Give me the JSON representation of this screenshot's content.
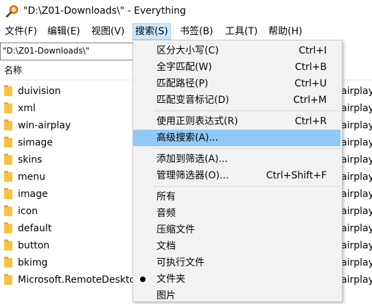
{
  "window": {
    "title": "\"D:\\Z01-Downloads\\\"  - Everything"
  },
  "menubar": {
    "items": [
      {
        "label": "文件(F)"
      },
      {
        "label": "编辑(E)"
      },
      {
        "label": "视图(V)"
      },
      {
        "label": "搜索(S)",
        "active": true
      },
      {
        "label": "书签(B)"
      },
      {
        "label": "工具(T)"
      },
      {
        "label": "帮助(H)"
      }
    ]
  },
  "search": {
    "value": "\"D:\\Z01-Downloads\\\""
  },
  "columns": {
    "name": "名称"
  },
  "files": [
    {
      "name": "duivision",
      "path": "airplay"
    },
    {
      "name": "xml",
      "path": "airplay"
    },
    {
      "name": "win-airplay",
      "path": "airplay"
    },
    {
      "name": "simage",
      "path": "airplay"
    },
    {
      "name": "skins",
      "path": "airplay"
    },
    {
      "name": "menu",
      "path": "airplay"
    },
    {
      "name": "image",
      "path": "airplay"
    },
    {
      "name": "icon",
      "path": "airplay"
    },
    {
      "name": "default",
      "path": "airplay"
    },
    {
      "name": "button",
      "path": "airplay"
    },
    {
      "name": "bkimg",
      "path": "airplay"
    },
    {
      "name": "Microsoft.RemoteDeskto",
      "path": "airplay"
    }
  ],
  "search_menu": {
    "items": [
      {
        "label": "区分大小写(C)",
        "shortcut": "Ctrl+I"
      },
      {
        "label": "全字匹配(W)",
        "shortcut": "Ctrl+B"
      },
      {
        "label": "匹配路径(P)",
        "shortcut": "Ctrl+U"
      },
      {
        "label": "匹配变音标记(D)",
        "shortcut": "Ctrl+M"
      },
      {
        "label": "使用正则表达式(R)",
        "shortcut": "Ctrl+R"
      },
      {
        "label": "高级搜索(A)...",
        "shortcut": "",
        "highlighted": true
      },
      {
        "label": "添加到筛选(A)...",
        "shortcut": ""
      },
      {
        "label": "管理筛选器(O)...",
        "shortcut": "Ctrl+Shift+F"
      },
      {
        "label": "所有",
        "shortcut": ""
      },
      {
        "label": "音频",
        "shortcut": ""
      },
      {
        "label": "压缩文件",
        "shortcut": ""
      },
      {
        "label": "文档",
        "shortcut": ""
      },
      {
        "label": "可执行文件",
        "shortcut": ""
      },
      {
        "label": "文件夹",
        "shortcut": "",
        "checked": true
      },
      {
        "label": "图片",
        "shortcut": ""
      }
    ]
  },
  "colors": {
    "highlight": "#91c9f7",
    "menu_bg": "#f2f2f2",
    "folder": "#f5c342",
    "menubar_active": "#cce8ff"
  }
}
